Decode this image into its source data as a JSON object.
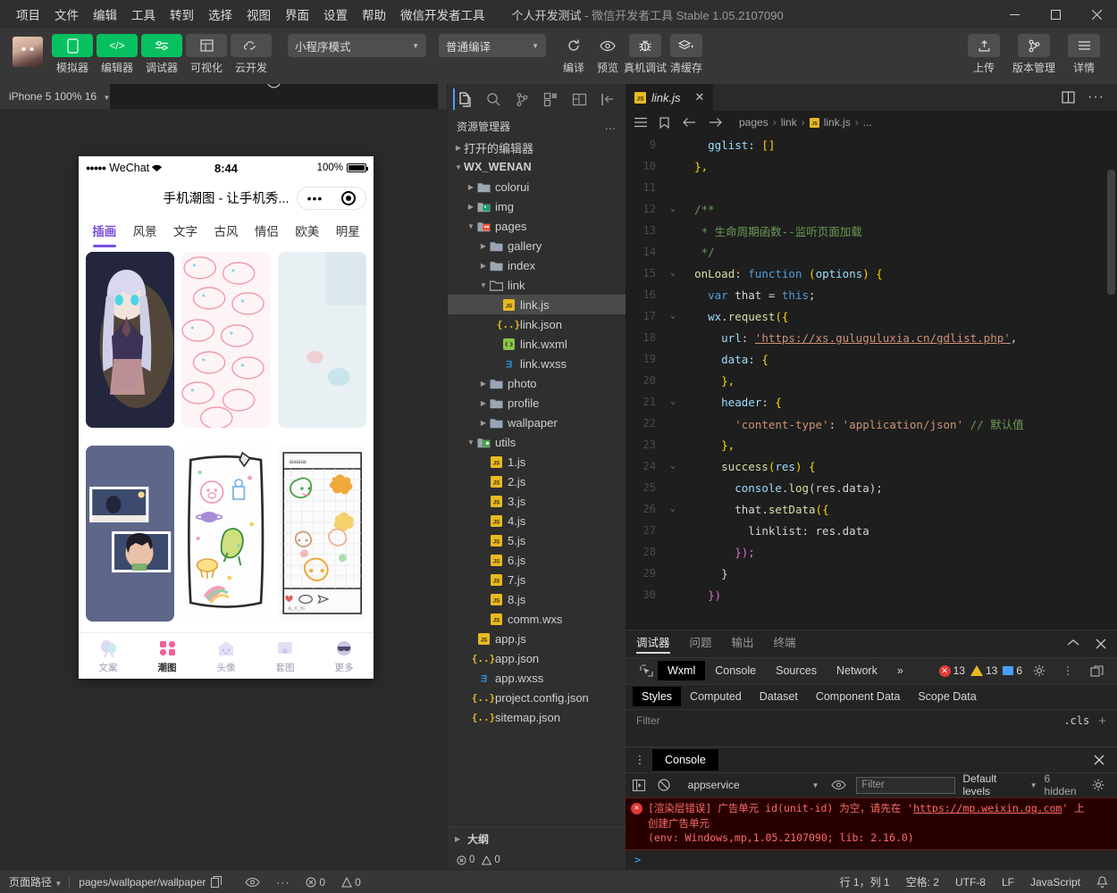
{
  "titlebar": {
    "menus": [
      "项目",
      "文件",
      "编辑",
      "工具",
      "转到",
      "选择",
      "视图",
      "界面",
      "设置",
      "帮助",
      "微信开发者工具"
    ],
    "project_name": "个人开发测试",
    "app_name_version": "- 微信开发者工具 Stable 1.05.2107090",
    "window_controls": [
      "minimize",
      "maximize",
      "close"
    ]
  },
  "toolbar": {
    "mode_buttons": [
      {
        "label": "模拟器",
        "icon": "phone-icon",
        "style": "green"
      },
      {
        "label": "编辑器",
        "icon": "code-icon",
        "style": "green"
      },
      {
        "label": "调试器",
        "icon": "debug-slider-icon",
        "style": "green"
      },
      {
        "label": "可视化",
        "icon": "layout-icon",
        "style": "grey"
      },
      {
        "label": "云开发",
        "icon": "cloud-icon",
        "style": "grey"
      }
    ],
    "mode_select": "小程序模式",
    "compile_select": "普通编译",
    "action_buttons": [
      {
        "label": "编译",
        "icon": "refresh-icon"
      },
      {
        "label": "预览",
        "icon": "eye-icon"
      },
      {
        "label": "真机调试",
        "icon": "bug-icon"
      },
      {
        "label": "清缓存",
        "icon": "layers-icon"
      }
    ],
    "right_buttons": [
      {
        "label": "上传",
        "icon": "upload-icon"
      },
      {
        "label": "版本管理",
        "icon": "branch-icon"
      },
      {
        "label": "详情",
        "icon": "menu-icon"
      }
    ]
  },
  "simulator": {
    "device_label": "iPhone 5 100% 16",
    "toolbar_icons": [
      "rotate-device-icon",
      "record-icon",
      "volume-icon",
      "multi-window-icon"
    ],
    "phone": {
      "carrier": "WeChat",
      "signal_dots": "●●●●●",
      "time": "8:44",
      "battery_percent": "100%",
      "nav_title": "手机潮图 - 让手机秀...",
      "capsule": {
        "more": "•••",
        "target": "target-icon"
      },
      "categories": [
        "插画",
        "风景",
        "文字",
        "古风",
        "情侣",
        "欧美",
        "明星"
      ],
      "active_category": "插画",
      "tabbar": [
        {
          "label": "文案",
          "icon": "balloon-icon"
        },
        {
          "label": "潮图",
          "icon": "grid-squares-icon"
        },
        {
          "label": "头像",
          "icon": "house-face-icon"
        },
        {
          "label": "套图",
          "icon": "frame-icon"
        },
        {
          "label": "更多",
          "icon": "sunglasses-face-icon"
        }
      ],
      "active_tab": "潮图"
    }
  },
  "explorer": {
    "activity_icons": [
      "files-icon",
      "search-icon",
      "source-control-icon",
      "extensions-icon",
      "wxml-panel-icon",
      "collapse-icon"
    ],
    "title": "资源管理器",
    "more": "...",
    "tree": [
      {
        "label": "打开的编辑器",
        "depth": 0,
        "type": "section",
        "arrow": "collapsed",
        "bold": false
      },
      {
        "label": "WX_WENAN",
        "depth": 0,
        "type": "root",
        "arrow": "expanded",
        "bold": true
      },
      {
        "label": "colorui",
        "depth": 1,
        "type": "folder",
        "arrow": "collapsed"
      },
      {
        "label": "img",
        "depth": 1,
        "type": "folder-img",
        "arrow": "collapsed"
      },
      {
        "label": "pages",
        "depth": 1,
        "type": "folder-pages",
        "arrow": "expanded"
      },
      {
        "label": "gallery",
        "depth": 2,
        "type": "folder",
        "arrow": "collapsed"
      },
      {
        "label": "index",
        "depth": 2,
        "type": "folder",
        "arrow": "collapsed"
      },
      {
        "label": "link",
        "depth": 2,
        "type": "folder-open",
        "arrow": "expanded"
      },
      {
        "label": "link.js",
        "depth": 3,
        "type": "js",
        "arrow": "none",
        "selected": true
      },
      {
        "label": "link.json",
        "depth": 3,
        "type": "json",
        "arrow": "none"
      },
      {
        "label": "link.wxml",
        "depth": 3,
        "type": "wxml",
        "arrow": "none"
      },
      {
        "label": "link.wxss",
        "depth": 3,
        "type": "wxss",
        "arrow": "none"
      },
      {
        "label": "photo",
        "depth": 2,
        "type": "folder",
        "arrow": "collapsed"
      },
      {
        "label": "profile",
        "depth": 2,
        "type": "folder",
        "arrow": "collapsed"
      },
      {
        "label": "wallpaper",
        "depth": 2,
        "type": "folder",
        "arrow": "collapsed"
      },
      {
        "label": "utils",
        "depth": 1,
        "type": "folder-utils",
        "arrow": "expanded"
      },
      {
        "label": "1.js",
        "depth": 2,
        "type": "js",
        "arrow": "none"
      },
      {
        "label": "2.js",
        "depth": 2,
        "type": "js",
        "arrow": "none"
      },
      {
        "label": "3.js",
        "depth": 2,
        "type": "js",
        "arrow": "none"
      },
      {
        "label": "4.js",
        "depth": 2,
        "type": "js",
        "arrow": "none"
      },
      {
        "label": "5.js",
        "depth": 2,
        "type": "js",
        "arrow": "none"
      },
      {
        "label": "6.js",
        "depth": 2,
        "type": "js",
        "arrow": "none"
      },
      {
        "label": "7.js",
        "depth": 2,
        "type": "js",
        "arrow": "none"
      },
      {
        "label": "8.js",
        "depth": 2,
        "type": "js",
        "arrow": "none"
      },
      {
        "label": "comm.wxs",
        "depth": 2,
        "type": "js",
        "arrow": "none"
      },
      {
        "label": "app.js",
        "depth": 1,
        "type": "js",
        "arrow": "none"
      },
      {
        "label": "app.json",
        "depth": 1,
        "type": "json",
        "arrow": "none"
      },
      {
        "label": "app.wxss",
        "depth": 1,
        "type": "wxss",
        "arrow": "none"
      },
      {
        "label": "project.config.json",
        "depth": 1,
        "type": "json",
        "arrow": "none"
      },
      {
        "label": "sitemap.json",
        "depth": 1,
        "type": "json",
        "arrow": "none"
      }
    ],
    "outline_label": "大纲",
    "problem_errors": "0",
    "problem_warnings": "0"
  },
  "editor": {
    "tab": {
      "label": "link.js",
      "icon": "js-icon",
      "close": "✕"
    },
    "tab_actions": [
      "split-editor-icon",
      "more-actions-icon"
    ],
    "breadcrumb_nav": [
      "outline-list-icon",
      "bookmark-icon",
      "back-arrow-icon",
      "forward-arrow-icon"
    ],
    "breadcrumbs": [
      "pages",
      "link",
      "link.js",
      "..."
    ],
    "lines": [
      {
        "num": "9",
        "fold": "",
        "indent": 2,
        "tokens": [
          {
            "t": "gglist",
            "c": "k-key"
          },
          {
            "t": ": ",
            "c": "k-plain"
          },
          {
            "t": "[]",
            "c": "k-br"
          }
        ]
      },
      {
        "num": "10",
        "fold": "",
        "indent": 1,
        "tokens": [
          {
            "t": "},",
            "c": "k-br"
          }
        ]
      },
      {
        "num": "11",
        "fold": "",
        "indent": 0,
        "tokens": []
      },
      {
        "num": "12",
        "fold": "v",
        "indent": 1,
        "tokens": [
          {
            "t": "/**",
            "c": "k-com"
          }
        ]
      },
      {
        "num": "13",
        "fold": "",
        "indent": 1,
        "tokens": [
          {
            "t": " * 生命周期函数--监听页面加载",
            "c": "k-com"
          }
        ]
      },
      {
        "num": "14",
        "fold": "",
        "indent": 1,
        "tokens": [
          {
            "t": " */",
            "c": "k-com"
          }
        ]
      },
      {
        "num": "15",
        "fold": "v",
        "indent": 1,
        "tokens": [
          {
            "t": "onLoad",
            "c": "k-fn"
          },
          {
            "t": ": ",
            "c": "k-plain"
          },
          {
            "t": "function",
            "c": "k-kw"
          },
          {
            "t": " (",
            "c": "k-br"
          },
          {
            "t": "options",
            "c": "k-var"
          },
          {
            "t": ") {",
            "c": "k-br"
          }
        ]
      },
      {
        "num": "16",
        "fold": "",
        "indent": 2,
        "tokens": [
          {
            "t": "var",
            "c": "k-kw"
          },
          {
            "t": " that = ",
            "c": "k-plain"
          },
          {
            "t": "this",
            "c": "k-kw"
          },
          {
            "t": ";",
            "c": "k-plain"
          }
        ]
      },
      {
        "num": "17",
        "fold": "v",
        "indent": 2,
        "tokens": [
          {
            "t": "wx",
            "c": "k-var"
          },
          {
            "t": ".",
            "c": "k-plain"
          },
          {
            "t": "request",
            "c": "k-fn"
          },
          {
            "t": "({",
            "c": "k-br"
          }
        ]
      },
      {
        "num": "18",
        "fold": "",
        "indent": 3,
        "tokens": [
          {
            "t": "url",
            "c": "k-key"
          },
          {
            "t": ": ",
            "c": "k-plain"
          },
          {
            "t": "'https://xs.guluguluxia.cn/gdlist.php'",
            "c": "k-url"
          },
          {
            "t": ",",
            "c": "k-plain"
          }
        ]
      },
      {
        "num": "19",
        "fold": "",
        "indent": 3,
        "tokens": [
          {
            "t": "data",
            "c": "k-key"
          },
          {
            "t": ": ",
            "c": "k-plain"
          },
          {
            "t": "{",
            "c": "k-br"
          }
        ]
      },
      {
        "num": "20",
        "fold": "",
        "indent": 3,
        "tokens": [
          {
            "t": "},",
            "c": "k-br"
          }
        ]
      },
      {
        "num": "21",
        "fold": "v",
        "indent": 3,
        "tokens": [
          {
            "t": "header",
            "c": "k-key"
          },
          {
            "t": ": ",
            "c": "k-plain"
          },
          {
            "t": "{",
            "c": "k-br"
          }
        ]
      },
      {
        "num": "22",
        "fold": "",
        "indent": 4,
        "tokens": [
          {
            "t": "'content-type'",
            "c": "k-str"
          },
          {
            "t": ": ",
            "c": "k-plain"
          },
          {
            "t": "'application/json'",
            "c": "k-str"
          },
          {
            "t": " // 默认值",
            "c": "k-com"
          }
        ]
      },
      {
        "num": "23",
        "fold": "",
        "indent": 3,
        "tokens": [
          {
            "t": "},",
            "c": "k-br"
          }
        ]
      },
      {
        "num": "24",
        "fold": "v",
        "indent": 3,
        "tokens": [
          {
            "t": "success",
            "c": "k-fn"
          },
          {
            "t": "(",
            "c": "k-br"
          },
          {
            "t": "res",
            "c": "k-var"
          },
          {
            "t": ") {",
            "c": "k-br"
          }
        ]
      },
      {
        "num": "25",
        "fold": "",
        "indent": 4,
        "tokens": [
          {
            "t": "console",
            "c": "k-var"
          },
          {
            "t": ".",
            "c": "k-plain"
          },
          {
            "t": "log",
            "c": "k-fn"
          },
          {
            "t": "(res.data);",
            "c": "k-plain"
          }
        ]
      },
      {
        "num": "26",
        "fold": "v",
        "indent": 4,
        "tokens": [
          {
            "t": "that",
            "c": "k-plain"
          },
          {
            "t": ".",
            "c": "k-plain"
          },
          {
            "t": "setData",
            "c": "k-fn"
          },
          {
            "t": "({",
            "c": "k-br"
          }
        ]
      },
      {
        "num": "27",
        "fold": "",
        "indent": 5,
        "tokens": [
          {
            "t": "linklist",
            "c": "k-plain"
          },
          {
            "t": ": res.data",
            "c": "k-plain"
          }
        ]
      },
      {
        "num": "28",
        "fold": "",
        "indent": 4,
        "tokens": [
          {
            "t": "});",
            "c": "k-br2"
          }
        ]
      },
      {
        "num": "29",
        "fold": "",
        "indent": 3,
        "tokens": [
          {
            "t": "}",
            "c": "k-plain"
          }
        ]
      },
      {
        "num": "30",
        "fold": "",
        "indent": 2,
        "tokens": [
          {
            "t": "})",
            "c": "k-br2"
          }
        ]
      }
    ]
  },
  "debugger": {
    "panel_tabs": [
      "调试器",
      "问题",
      "输出",
      "终端"
    ],
    "active_panel_tab": "调试器",
    "panel_actions": [
      "chevron-up-icon",
      "close-icon"
    ],
    "devtool_tabs": [
      "Wxml",
      "Console",
      "Sources",
      "Network"
    ],
    "active_devtool_tab": "Wxml",
    "overflow": "»",
    "inspect_icon": "inspect-element-icon",
    "counts": {
      "errors": "13",
      "warnings": "13",
      "infos": "6"
    },
    "right_icons": [
      "gear-icon",
      "kebab-icon",
      "dock-icon"
    ],
    "style_tabs": [
      "Styles",
      "Computed",
      "Dataset",
      "Component Data",
      "Scope Data"
    ],
    "active_style_tab": "Styles",
    "filter_placeholder": "Filter",
    "cls_label": ".cls",
    "add_rule": "+"
  },
  "console": {
    "kebab": "⋮",
    "tab_label": "Console",
    "close": "✕",
    "tool_icons": [
      "sidebar-toggle-icon",
      "clear-console-icon",
      "eye-icon"
    ],
    "context": "appservice",
    "filter_placeholder": "Filter",
    "levels": "Default levels",
    "hidden_count": "6 hidden",
    "settings_icon": "gear-icon",
    "message": {
      "prefix": "[渲染层错误] 广告单元 id(unit-id) 为空，请先在 ",
      "link": "https://mp.weixin.qq.com",
      "suffix": "' 上",
      "quote_open": "'",
      "line2": "创建广告单元",
      "line3": "(env: Windows,mp,1.05.2107090; lib: 2.16.0)"
    },
    "prompt": ">"
  },
  "statusbar": {
    "page_path_label": "页面路径",
    "page_path_value": "pages/wallpaper/wallpaper",
    "copy_icon": "copy-icon",
    "eye_icon": "eye-icon",
    "more_icon": "more-icon",
    "errors": "0",
    "warnings": "0",
    "cursor": "行 1，列 1",
    "spaces": "空格: 2",
    "encoding": "UTF-8",
    "eol": "LF",
    "language": "JavaScript",
    "bell_icon": "bell-icon"
  },
  "colors": {
    "accent_green": "#07c160",
    "error_red": "#e53935",
    "warning_yellow": "#e8b923",
    "info_blue": "#4a9eff",
    "tab_purple": "#7b4ee0"
  }
}
